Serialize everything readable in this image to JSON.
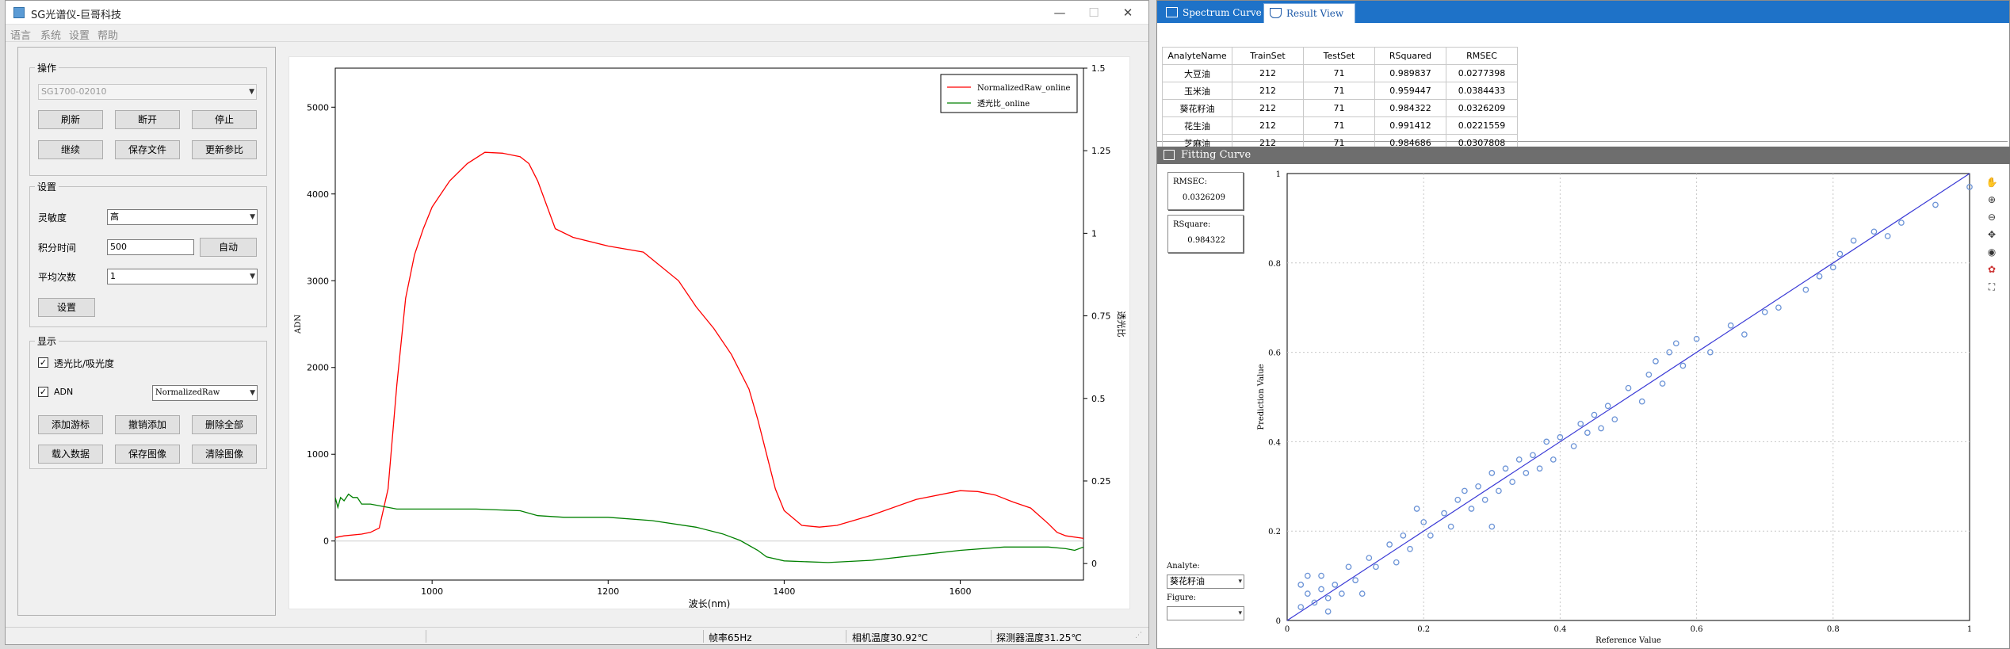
{
  "left_window": {
    "title": "SG光谱仪-巨哥科技",
    "minimize_glyph": "—",
    "maximize_glyph": "☐",
    "close_glyph": "✕",
    "menu": [
      "语言",
      "系统",
      "设置",
      "帮助"
    ],
    "groups": {
      "operation": {
        "title": "操作",
        "device_combo": "SG1700-02010",
        "buttons": [
          "刷新",
          "断开",
          "停止",
          "继续",
          "保存文件",
          "更新参比"
        ]
      },
      "settings": {
        "title": "设置",
        "sensitivity_label": "灵敏度",
        "sensitivity_value": "高",
        "integration_label": "积分时间",
        "integration_value": "500",
        "auto_button": "自动",
        "average_label": "平均次数",
        "average_value": "1",
        "set_button": "设置"
      },
      "display": {
        "title": "显示",
        "transmittance_check": "透光比/吸光度",
        "transmittance_checked": true,
        "adn_check": "ADN",
        "adn_checked": true,
        "adn_mode": "NormalizedRaw",
        "buttons": [
          "添加游标",
          "撤销添加",
          "删除全部",
          "载入数据",
          "保存图像",
          "清除图像"
        ]
      }
    },
    "status": {
      "frame_rate": "帧率65Hz",
      "camera_temp": "相机温度30.92℃",
      "detector_temp": "探测器温度31.25℃"
    }
  },
  "right_window": {
    "tabs": [
      {
        "label": "Spectrum Curve",
        "icon": "calendar-icon",
        "active": false
      },
      {
        "label": "Result View",
        "icon": "flask-icon",
        "active": true
      }
    ],
    "table": {
      "columns": [
        "AnalyteName",
        "TrainSet",
        "TestSet",
        "RSquared",
        "RMSEC"
      ],
      "rows": [
        [
          "大豆油",
          "212",
          "71",
          "0.989837",
          "0.0277398"
        ],
        [
          "玉米油",
          "212",
          "71",
          "0.959447",
          "0.0384433"
        ],
        [
          "葵花籽油",
          "212",
          "71",
          "0.984322",
          "0.0326209"
        ],
        [
          "花生油",
          "212",
          "71",
          "0.991412",
          "0.0221559"
        ],
        [
          "芝麻油",
          "212",
          "71",
          "0.984686",
          "0.0307808"
        ]
      ]
    },
    "fitting_title": "Fitting Curve",
    "rmsec_label": "RMSEC:",
    "rmsec_value": "0.0326209",
    "rsquare_label": "RSquare:",
    "rsquare_value": "0.984322",
    "analyte_label": "Analyte:",
    "analyte_value": "葵花籽油",
    "figure_label": "Figure:",
    "figure_value": "",
    "toolbar_icons": [
      "hand-icon",
      "zoom-in-icon",
      "zoom-out-icon",
      "pan-icon",
      "eye-icon",
      "palette-icon",
      "fit-view-icon"
    ]
  },
  "chart_data": [
    {
      "type": "line",
      "title": "",
      "xlabel": "波长(nm)",
      "ylabel": "ADN",
      "y2label": "透光比",
      "xlim": [
        890,
        1740
      ],
      "ylim": [
        -450,
        5450
      ],
      "y2lim": [
        -0.05,
        1.5
      ],
      "xticks": [
        1000,
        1200,
        1400,
        1600
      ],
      "yticks": [
        0,
        1000,
        2000,
        3000,
        4000,
        5000
      ],
      "y2ticks": [
        "0",
        "0.25",
        "0.5",
        "0.75",
        "1",
        "1.25",
        "1.5"
      ],
      "legend_position": "top-right",
      "series": [
        {
          "name": "NormalizedRaw_online",
          "axis": "left",
          "color": "#ff0000",
          "x": [
            890,
            900,
            920,
            930,
            940,
            950,
            960,
            970,
            980,
            990,
            1000,
            1020,
            1040,
            1060,
            1080,
            1100,
            1110,
            1120,
            1140,
            1160,
            1200,
            1240,
            1280,
            1300,
            1320,
            1340,
            1360,
            1370,
            1380,
            1390,
            1400,
            1420,
            1440,
            1460,
            1480,
            1500,
            1550,
            1600,
            1620,
            1640,
            1660,
            1680,
            1700,
            1710,
            1720,
            1740
          ],
          "y": [
            40,
            60,
            80,
            100,
            150,
            600,
            1800,
            2800,
            3300,
            3600,
            3850,
            4150,
            4350,
            4480,
            4470,
            4430,
            4350,
            4150,
            3600,
            3500,
            3400,
            3330,
            3000,
            2700,
            2450,
            2150,
            1750,
            1400,
            1000,
            600,
            350,
            180,
            160,
            180,
            240,
            300,
            480,
            580,
            570,
            530,
            450,
            380,
            200,
            100,
            60,
            30
          ]
        },
        {
          "name": "透光比_online",
          "axis": "right",
          "color": "#008000",
          "x": [
            890,
            893,
            896,
            900,
            905,
            910,
            915,
            920,
            930,
            960,
            1000,
            1050,
            1100,
            1120,
            1150,
            1200,
            1250,
            1300,
            1330,
            1350,
            1370,
            1380,
            1400,
            1450,
            1500,
            1550,
            1600,
            1650,
            1700,
            1720,
            1730,
            1740
          ],
          "y": [
            0.2,
            0.17,
            0.2,
            0.19,
            0.21,
            0.2,
            0.2,
            0.18,
            0.18,
            0.165,
            0.165,
            0.165,
            0.16,
            0.145,
            0.14,
            0.14,
            0.13,
            0.11,
            0.09,
            0.07,
            0.04,
            0.02,
            0.008,
            0.003,
            0.01,
            0.025,
            0.04,
            0.05,
            0.05,
            0.045,
            0.04,
            0.05
          ]
        }
      ]
    },
    {
      "type": "scatter",
      "title": "",
      "xlabel": "Reference Value",
      "ylabel": "Prediction Value",
      "xlim": [
        0,
        1
      ],
      "ylim": [
        0,
        1
      ],
      "ticks": [
        "0",
        "0.2",
        "0.4",
        "0.6",
        "0.8",
        "1"
      ],
      "grid": true,
      "fit_line": [
        [
          0,
          0
        ],
        [
          1,
          1
        ]
      ],
      "series": [
        {
          "name": "",
          "color": "#6b93d6",
          "points": [
            [
              0.02,
              0.03
            ],
            [
              0.03,
              0.06
            ],
            [
              0.04,
              0.04
            ],
            [
              0.05,
              0.1
            ],
            [
              0.05,
              0.07
            ],
            [
              0.06,
              0.05
            ],
            [
              0.07,
              0.08
            ],
            [
              0.08,
              0.06
            ],
            [
              0.09,
              0.12
            ],
            [
              0.1,
              0.09
            ],
            [
              0.12,
              0.14
            ],
            [
              0.13,
              0.12
            ],
            [
              0.15,
              0.17
            ],
            [
              0.16,
              0.13
            ],
            [
              0.17,
              0.19
            ],
            [
              0.18,
              0.16
            ],
            [
              0.2,
              0.22
            ],
            [
              0.21,
              0.19
            ],
            [
              0.23,
              0.24
            ],
            [
              0.24,
              0.21
            ],
            [
              0.25,
              0.27
            ],
            [
              0.26,
              0.29
            ],
            [
              0.27,
              0.25
            ],
            [
              0.28,
              0.3
            ],
            [
              0.29,
              0.27
            ],
            [
              0.3,
              0.33
            ],
            [
              0.31,
              0.29
            ],
            [
              0.32,
              0.34
            ],
            [
              0.33,
              0.31
            ],
            [
              0.34,
              0.36
            ],
            [
              0.35,
              0.33
            ],
            [
              0.36,
              0.37
            ],
            [
              0.37,
              0.34
            ],
            [
              0.38,
              0.4
            ],
            [
              0.39,
              0.36
            ],
            [
              0.4,
              0.41
            ],
            [
              0.42,
              0.39
            ],
            [
              0.43,
              0.44
            ],
            [
              0.44,
              0.42
            ],
            [
              0.45,
              0.46
            ],
            [
              0.46,
              0.43
            ],
            [
              0.47,
              0.48
            ],
            [
              0.5,
              0.52
            ],
            [
              0.52,
              0.49
            ],
            [
              0.53,
              0.55
            ],
            [
              0.54,
              0.58
            ],
            [
              0.55,
              0.53
            ],
            [
              0.56,
              0.6
            ],
            [
              0.58,
              0.57
            ],
            [
              0.6,
              0.63
            ],
            [
              0.62,
              0.6
            ],
            [
              0.65,
              0.66
            ],
            [
              0.67,
              0.64
            ],
            [
              0.7,
              0.69
            ],
            [
              0.72,
              0.7
            ],
            [
              0.76,
              0.74
            ],
            [
              0.78,
              0.77
            ],
            [
              0.8,
              0.79
            ],
            [
              0.81,
              0.82
            ],
            [
              0.83,
              0.85
            ],
            [
              0.86,
              0.87
            ],
            [
              0.88,
              0.86
            ],
            [
              0.9,
              0.89
            ],
            [
              0.95,
              0.93
            ],
            [
              1.0,
              0.97
            ],
            [
              0.02,
              0.08
            ],
            [
              0.03,
              0.1
            ],
            [
              0.06,
              0.02
            ],
            [
              0.11,
              0.06
            ],
            [
              0.19,
              0.25
            ],
            [
              0.3,
              0.21
            ],
            [
              0.48,
              0.45
            ],
            [
              0.57,
              0.62
            ]
          ]
        }
      ]
    }
  ]
}
